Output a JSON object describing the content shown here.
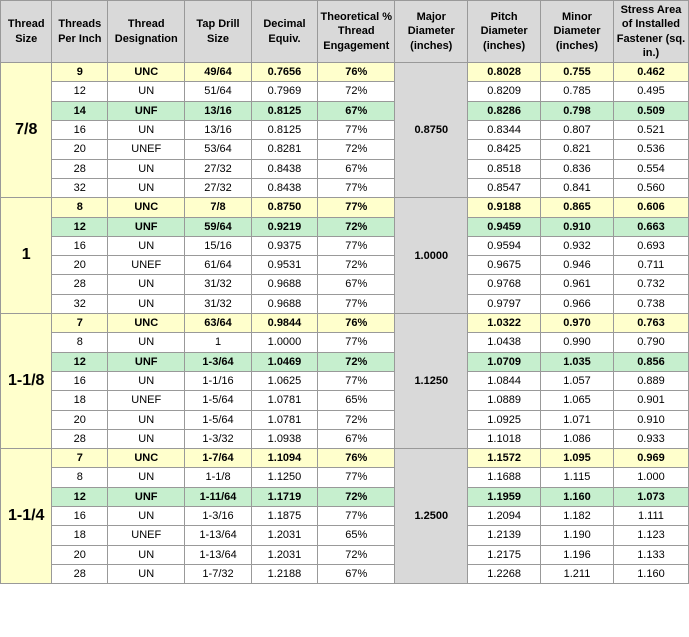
{
  "headers": {
    "col1": "Thread Size",
    "col2": "Threads Per Inch",
    "col3": "Thread Designation",
    "col4": "Tap Drill Size",
    "col5": "Decimal Equiv.",
    "col6": "Theoretical % Thread Engagement",
    "col7": "Major Diameter (inches)",
    "col8": "Pitch Diameter (inches)",
    "col9": "Minor Diameter (inches)",
    "col10": "Stress Area of Installed Fastener (sq. in.)"
  },
  "rows": [
    {
      "size": "7/8",
      "tpi": "9",
      "desig": "UNC",
      "drill": "49/64",
      "dec": "0.7656",
      "pct": "76%",
      "major": "",
      "pitch": "0.8028",
      "minor": "0.755",
      "stress": "0.462",
      "type": "unc",
      "rowspan": 7,
      "majorVal": "0.8750"
    },
    {
      "size": "",
      "tpi": "12",
      "desig": "UN",
      "drill": "51/64",
      "dec": "0.7969",
      "pct": "72%",
      "major": "",
      "pitch": "0.8209",
      "minor": "0.785",
      "stress": "0.495",
      "type": "normal"
    },
    {
      "size": "",
      "tpi": "14",
      "desig": "UNF",
      "drill": "13/16",
      "dec": "0.8125",
      "pct": "67%",
      "major": "",
      "pitch": "0.8286",
      "minor": "0.798",
      "stress": "0.509",
      "type": "unf"
    },
    {
      "size": "",
      "tpi": "16",
      "desig": "UN",
      "drill": "13/16",
      "dec": "0.8125",
      "pct": "77%",
      "major": "",
      "pitch": "0.8344",
      "minor": "0.807",
      "stress": "0.521",
      "type": "normal"
    },
    {
      "size": "",
      "tpi": "20",
      "desig": "UNEF",
      "drill": "53/64",
      "dec": "0.8281",
      "pct": "72%",
      "major": "",
      "pitch": "0.8425",
      "minor": "0.821",
      "stress": "0.536",
      "type": "normal"
    },
    {
      "size": "",
      "tpi": "28",
      "desig": "UN",
      "drill": "27/32",
      "dec": "0.8438",
      "pct": "67%",
      "major": "",
      "pitch": "0.8518",
      "minor": "0.836",
      "stress": "0.554",
      "type": "normal"
    },
    {
      "size": "",
      "tpi": "32",
      "desig": "UN",
      "drill": "27/32",
      "dec": "0.8438",
      "pct": "77%",
      "major": "",
      "pitch": "0.8547",
      "minor": "0.841",
      "stress": "0.560",
      "type": "normal"
    },
    {
      "size": "1",
      "tpi": "8",
      "desig": "UNC",
      "drill": "7/8",
      "dec": "0.8750",
      "pct": "77%",
      "major": "",
      "pitch": "0.9188",
      "minor": "0.865",
      "stress": "0.606",
      "type": "unc",
      "rowspan": 6,
      "majorVal": "1.0000"
    },
    {
      "size": "",
      "tpi": "12",
      "desig": "UNF",
      "drill": "59/64",
      "dec": "0.9219",
      "pct": "72%",
      "major": "",
      "pitch": "0.9459",
      "minor": "0.910",
      "stress": "0.663",
      "type": "unf"
    },
    {
      "size": "",
      "tpi": "16",
      "desig": "UN",
      "drill": "15/16",
      "dec": "0.9375",
      "pct": "77%",
      "major": "",
      "pitch": "0.9594",
      "minor": "0.932",
      "stress": "0.693",
      "type": "normal"
    },
    {
      "size": "",
      "tpi": "20",
      "desig": "UNEF",
      "drill": "61/64",
      "dec": "0.9531",
      "pct": "72%",
      "major": "",
      "pitch": "0.9675",
      "minor": "0.946",
      "stress": "0.711",
      "type": "normal"
    },
    {
      "size": "",
      "tpi": "28",
      "desig": "UN",
      "drill": "31/32",
      "dec": "0.9688",
      "pct": "67%",
      "major": "",
      "pitch": "0.9768",
      "minor": "0.961",
      "stress": "0.732",
      "type": "normal"
    },
    {
      "size": "",
      "tpi": "32",
      "desig": "UN",
      "drill": "31/32",
      "dec": "0.9688",
      "pct": "77%",
      "major": "",
      "pitch": "0.9797",
      "minor": "0.966",
      "stress": "0.738",
      "type": "normal"
    },
    {
      "size": "1-1/8",
      "tpi": "7",
      "desig": "UNC",
      "drill": "63/64",
      "dec": "0.9844",
      "pct": "76%",
      "major": "",
      "pitch": "1.0322",
      "minor": "0.970",
      "stress": "0.763",
      "type": "unc",
      "rowspan": 7,
      "majorVal": "1.1250"
    },
    {
      "size": "",
      "tpi": "8",
      "desig": "UN",
      "drill": "1",
      "dec": "1.0000",
      "pct": "77%",
      "major": "",
      "pitch": "1.0438",
      "minor": "0.990",
      "stress": "0.790",
      "type": "normal"
    },
    {
      "size": "",
      "tpi": "12",
      "desig": "UNF",
      "drill": "1-3/64",
      "dec": "1.0469",
      "pct": "72%",
      "major": "",
      "pitch": "1.0709",
      "minor": "1.035",
      "stress": "0.856",
      "type": "unf"
    },
    {
      "size": "",
      "tpi": "16",
      "desig": "UN",
      "drill": "1-1/16",
      "dec": "1.0625",
      "pct": "77%",
      "major": "",
      "pitch": "1.0844",
      "minor": "1.057",
      "stress": "0.889",
      "type": "normal"
    },
    {
      "size": "",
      "tpi": "18",
      "desig": "UNEF",
      "drill": "1-5/64",
      "dec": "1.0781",
      "pct": "65%",
      "major": "",
      "pitch": "1.0889",
      "minor": "1.065",
      "stress": "0.901",
      "type": "normal"
    },
    {
      "size": "",
      "tpi": "20",
      "desig": "UN",
      "drill": "1-5/64",
      "dec": "1.0781",
      "pct": "72%",
      "major": "",
      "pitch": "1.0925",
      "minor": "1.071",
      "stress": "0.910",
      "type": "normal"
    },
    {
      "size": "",
      "tpi": "28",
      "desig": "UN",
      "drill": "1-3/32",
      "dec": "1.0938",
      "pct": "67%",
      "major": "",
      "pitch": "1.1018",
      "minor": "1.086",
      "stress": "0.933",
      "type": "normal"
    },
    {
      "size": "1-1/4",
      "tpi": "7",
      "desig": "UNC",
      "drill": "1-7/64",
      "dec": "1.1094",
      "pct": "76%",
      "major": "",
      "pitch": "1.1572",
      "minor": "1.095",
      "stress": "0.969",
      "type": "unc",
      "rowspan": 7,
      "majorVal": "1.2500"
    },
    {
      "size": "",
      "tpi": "8",
      "desig": "UN",
      "drill": "1-1/8",
      "dec": "1.1250",
      "pct": "77%",
      "major": "",
      "pitch": "1.1688",
      "minor": "1.115",
      "stress": "1.000",
      "type": "normal"
    },
    {
      "size": "",
      "tpi": "12",
      "desig": "UNF",
      "drill": "1-11/64",
      "dec": "1.1719",
      "pct": "72%",
      "major": "",
      "pitch": "1.1959",
      "minor": "1.160",
      "stress": "1.073",
      "type": "unf"
    },
    {
      "size": "",
      "tpi": "16",
      "desig": "UN",
      "drill": "1-3/16",
      "dec": "1.1875",
      "pct": "77%",
      "major": "",
      "pitch": "1.2094",
      "minor": "1.182",
      "stress": "1.111",
      "type": "normal"
    },
    {
      "size": "",
      "tpi": "18",
      "desig": "UNEF",
      "drill": "1-13/64",
      "dec": "1.2031",
      "pct": "65%",
      "major": "",
      "pitch": "1.2139",
      "minor": "1.190",
      "stress": "1.123",
      "type": "normal"
    },
    {
      "size": "",
      "tpi": "20",
      "desig": "UN",
      "drill": "1-13/64",
      "dec": "1.2031",
      "pct": "72%",
      "major": "",
      "pitch": "1.2175",
      "minor": "1.196",
      "stress": "1.133",
      "type": "normal"
    },
    {
      "size": "",
      "tpi": "28",
      "desig": "UN",
      "drill": "1-7/32",
      "dec": "1.2188",
      "pct": "67%",
      "major": "",
      "pitch": "1.2268",
      "minor": "1.211",
      "stress": "1.160",
      "type": "normal"
    }
  ]
}
